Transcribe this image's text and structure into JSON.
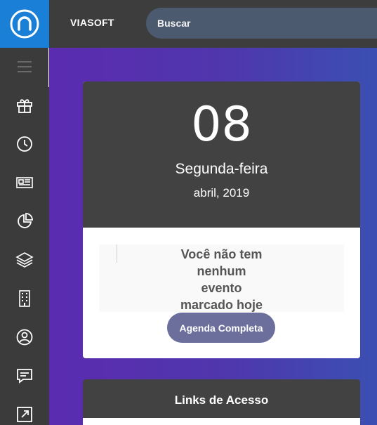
{
  "header": {
    "brand": "VIASOFT",
    "search_label": "Buscar"
  },
  "sidebar": {
    "items": [
      {
        "icon": "menu-icon"
      },
      {
        "icon": "gift-icon"
      },
      {
        "icon": "clock-icon"
      },
      {
        "icon": "newspaper-icon"
      },
      {
        "icon": "pie-chart-icon"
      },
      {
        "icon": "layers-icon"
      },
      {
        "icon": "building-icon"
      },
      {
        "icon": "user-circle-icon"
      },
      {
        "icon": "chat-icon"
      },
      {
        "icon": "external-link-icon"
      }
    ]
  },
  "calendar": {
    "day": "08",
    "weekday": "Segunda-feira",
    "month_year": "abril, 2019",
    "empty_message": "Você não tem nenhum evento marcado hoje",
    "button_label": "Agenda Completa"
  },
  "links": {
    "title": "Links de Acesso"
  },
  "colors": {
    "logo_bg": "#1a7fd6",
    "topbar_bg": "#3d3d3d",
    "card_header_bg": "#424242",
    "button_bg": "#6c6f9c",
    "gradient_start": "#5b2bb0",
    "gradient_end": "#3b4fb3"
  }
}
